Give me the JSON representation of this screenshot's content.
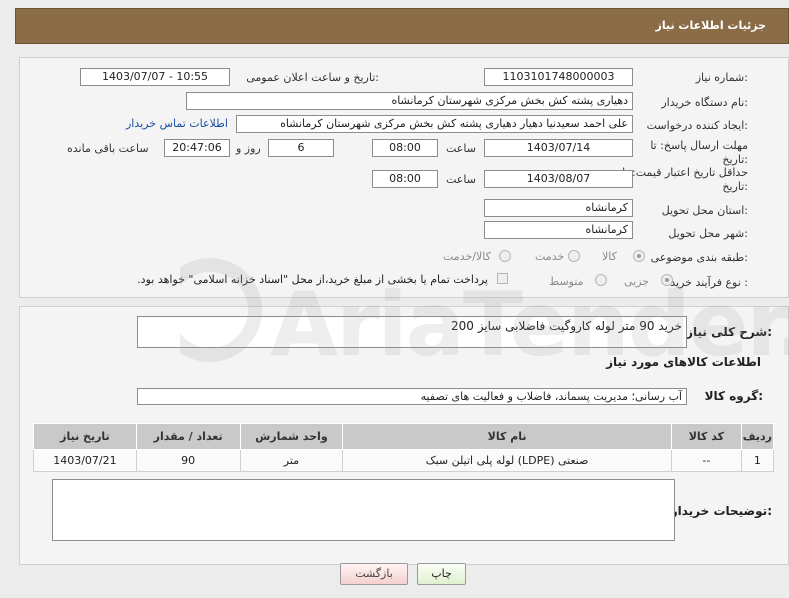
{
  "header": {
    "title": "جزئیات اطلاعات نیاز"
  },
  "fields": {
    "need_number": {
      "label": "شماره نیاز:",
      "value": "1103101748000003"
    },
    "announce_datetime": {
      "label": "تاریخ و ساعت اعلان عمومی:",
      "value": "1403/07/07 - 10:55"
    },
    "buyer_org": {
      "label": "نام دستگاه خریدار:",
      "value": "دهیاری پشته کش بخش مرکزی شهرستان کرمانشاه"
    },
    "creator": {
      "label": "ایجاد کننده درخواست:",
      "value": "علی احمد سعیدنیا دهیار دهیاری پشته کش بخش مرکزی شهرستان کرمانشاه",
      "contact_link": "اطلاعات تماس خریدار"
    },
    "reply_deadline": {
      "label_line1": "مهلت ارسال پاسخ: تا",
      "label_line2": "تاریخ:",
      "date": "1403/07/14",
      "time_label": "ساعت",
      "time": "08:00",
      "days": "6",
      "days_label": "روز و",
      "remaining": "20:47:06",
      "remaining_label": "ساعت باقی مانده"
    },
    "price_validity": {
      "label_line1": "حداقل تاریخ اعتبار قیمت: تا",
      "label_line2": "تاریخ:",
      "date": "1403/08/07",
      "time_label": "ساعت",
      "time": "08:00"
    },
    "province": {
      "label": "استان محل تحویل:",
      "value": "کرمانشاه"
    },
    "city": {
      "label": "شهر محل تحویل:",
      "value": "کرمانشاه"
    },
    "category": {
      "label": "طبقه بندی موضوعی:",
      "options": [
        "کالا",
        "خدمت",
        "کالا/خدمت"
      ],
      "selected": "کالا"
    },
    "process": {
      "label": "نوع فرآیند خرید :",
      "options": [
        "جزیی",
        "متوسط"
      ],
      "selected": "جزیی",
      "payment_note": "پرداخت تمام یا بخشی از مبلغ خرید،از محل \"اسناد خزانه اسلامی\" خواهد بود."
    }
  },
  "summary": {
    "label": "شرح کلی نیاز:",
    "value": "خرید 90 متر لوله کاروگیت فاضلابی سایز 200"
  },
  "goods_section": {
    "title": "اطلاعات کالاهای مورد نیاز",
    "group_label": "گروه کالا:",
    "group_value": "آب رسانی؛ مدیریت پسماند، فاضلاب و فعالیت های تصفیه",
    "columns": [
      "ردیف",
      "کد کالا",
      "نام کالا",
      "واحد شمارش",
      "تعداد / مقدار",
      "تاریخ نیاز"
    ],
    "rows": [
      [
        "1",
        "--",
        "لوله پلی اتیلن سبک (LDPE) صنعتی",
        "متر",
        "90",
        "1403/07/21"
      ]
    ]
  },
  "buyer_notes": {
    "label": "توضیحات خریدار:",
    "value": ""
  },
  "buttons": {
    "print": "چاپ",
    "back": "بازگشت"
  },
  "watermark": "AriaTender.net"
}
